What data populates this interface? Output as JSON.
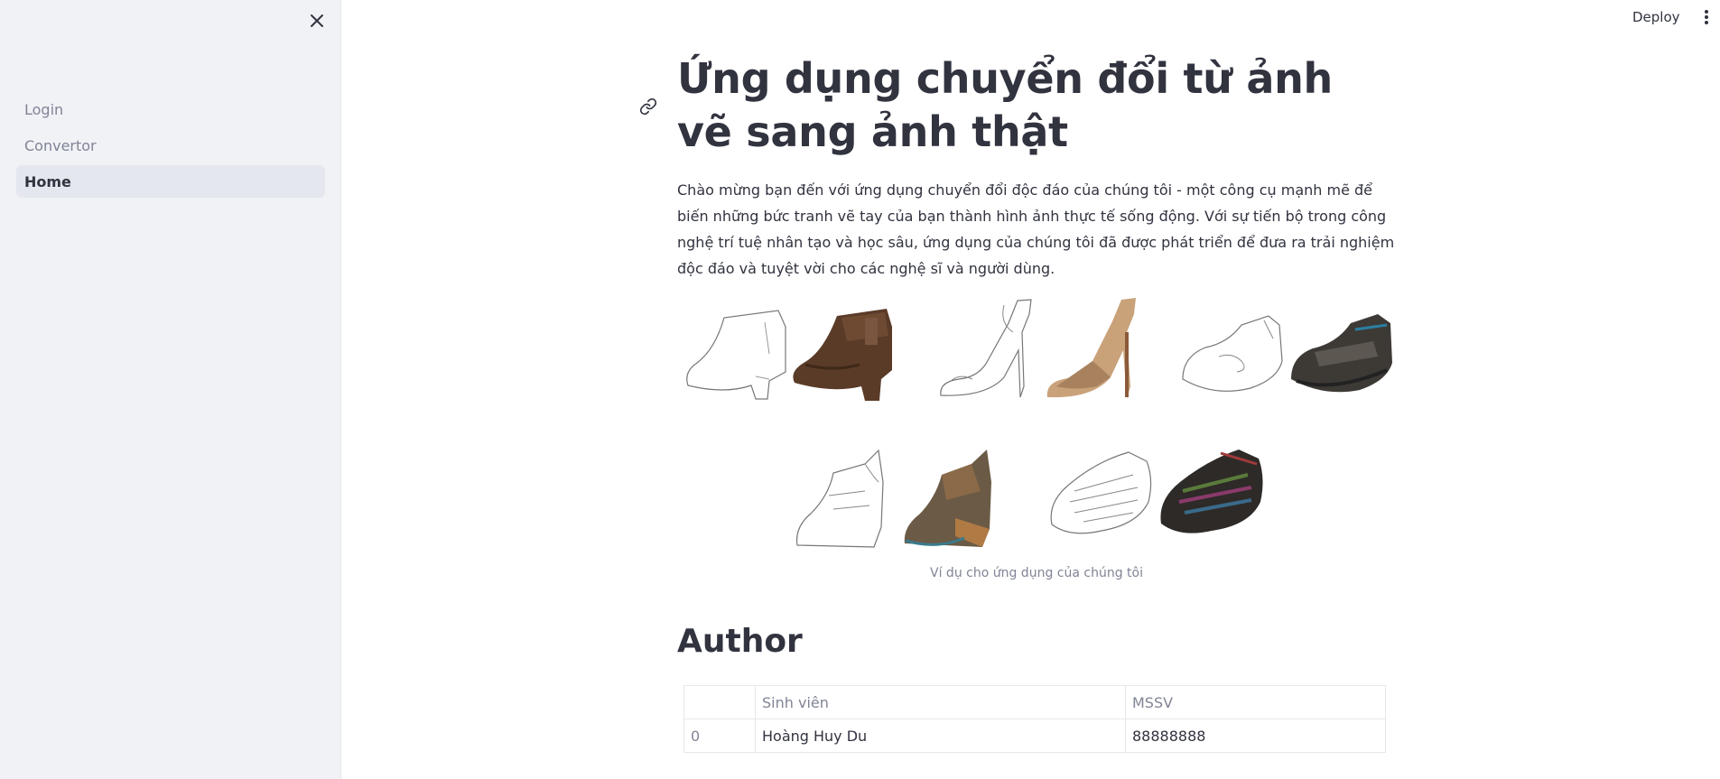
{
  "sidebar": {
    "items": [
      {
        "label": "Login",
        "active": false
      },
      {
        "label": "Convertor",
        "active": false
      },
      {
        "label": "Home",
        "active": true
      }
    ]
  },
  "header": {
    "deploy_label": "Deploy"
  },
  "main": {
    "title": "Ứng dụng chuyển đổi từ ảnh vẽ sang ảnh thật",
    "intro": "Chào mừng bạn đến với ứng dụng chuyển đổi độc đáo của chúng tôi - một công cụ mạnh mẽ để biến những bức tranh vẽ tay của bạn thành hình ảnh thực tế sống động. Với sự tiến bộ trong công nghệ trí tuệ nhân tạo và học sâu, ứng dụng của chúng tôi đã được phát triển để đưa ra trải nghiệm độc đáo và tuyệt vời cho các nghệ sĩ và người dùng.",
    "image_caption": "Ví dụ cho ứng dụng của chúng tôi",
    "author_heading": "Author",
    "table": {
      "headers": [
        "",
        "Sinh viên",
        "MSSV"
      ],
      "rows": [
        [
          "0",
          "Hoàng Huy Du",
          "88888888"
        ]
      ]
    }
  },
  "colors": {
    "sidebar_bg": "#f0f2f6",
    "text": "#31333f",
    "muted": "#808495"
  }
}
